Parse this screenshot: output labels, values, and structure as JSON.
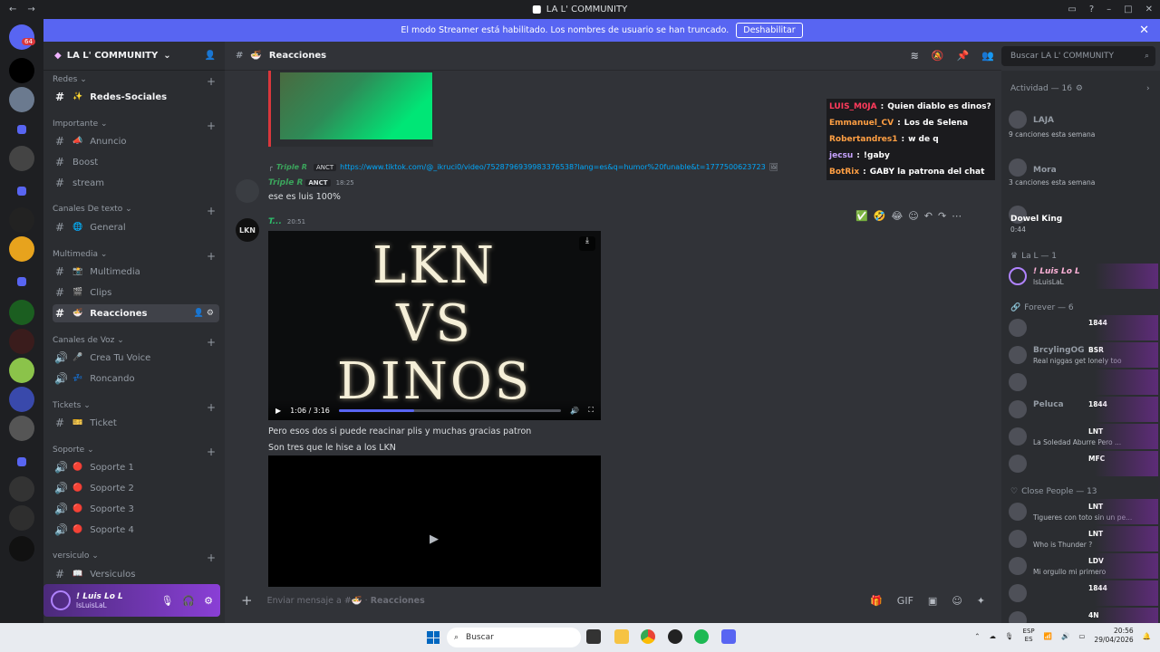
{
  "window": {
    "title": "LA L' COMMUNITY"
  },
  "banner": {
    "text": "El modo Streamer está habilitado. Los nombres de usuario se han truncado.",
    "button": "Deshabilitar"
  },
  "guild_badge": "64",
  "server": {
    "name": "LA L' COMMUNITY"
  },
  "categories": [
    {
      "name": "Redes",
      "channels": [
        {
          "name": "Redes-Sociales",
          "emoji": "✨"
        }
      ]
    },
    {
      "name": "Importante",
      "channels": [
        {
          "name": "Anuncio",
          "emoji": "📣"
        },
        {
          "name": "Boost",
          "emoji": ""
        },
        {
          "name": "stream",
          "emoji": ""
        }
      ]
    },
    {
      "name": "Canales De texto",
      "channels": [
        {
          "name": "General",
          "emoji": "🌐"
        }
      ]
    },
    {
      "name": "Multimedia",
      "channels": [
        {
          "name": "Multimedia",
          "emoji": "📸"
        },
        {
          "name": "Clips",
          "emoji": "🎬"
        },
        {
          "name": "Reacciones",
          "emoji": "🍜"
        }
      ]
    },
    {
      "name": "Canales de Voz",
      "channels": [
        {
          "name": "Crea Tu Voice",
          "emoji": "🎤"
        },
        {
          "name": "Roncando",
          "emoji": "💤"
        }
      ]
    },
    {
      "name": "Tickets",
      "channels": [
        {
          "name": "Ticket",
          "emoji": "🎫"
        }
      ]
    },
    {
      "name": "Soporte",
      "channels": [
        {
          "name": "Soporte 1",
          "emoji": "🔴"
        },
        {
          "name": "Soporte 2",
          "emoji": "🔴"
        },
        {
          "name": "Soporte 3",
          "emoji": "🔴"
        },
        {
          "name": "Soporte 4",
          "emoji": "🔴"
        }
      ]
    },
    {
      "name": "versiculo",
      "channels": [
        {
          "name": "Versiculos",
          "emoji": "📖"
        }
      ]
    }
  ],
  "user": {
    "name": "! Luis Lo L",
    "sub": "lsLuisLaL"
  },
  "channel": {
    "name": "Reacciones",
    "emoji": "🍜"
  },
  "search": {
    "placeholder": "Buscar LA L' COMMUNITY"
  },
  "messages": {
    "reply": {
      "user": "Triple R",
      "tag": "ANCT",
      "link": "https://www.tiktok.com/@_ikruci0/video/7528796939983376538?lang=es&q=humor%20funable&t=1777500623723"
    },
    "msg1": {
      "user": "Triple R",
      "tag": "ANCT",
      "time": "18:25",
      "text": "ese es luis 100%"
    },
    "msg2": {
      "user": "T...",
      "time": "20:51",
      "avatar_text": "LKN"
    },
    "video": {
      "title_lines": [
        "LKN",
        "VS",
        "DINOS"
      ],
      "time": "1:06 / 3:16",
      "progress": 0.34
    },
    "text2": "Pero esos dos si puede reacinar plis y muchas gracias patron",
    "text3": "Son tres que le hise a los LKN"
  },
  "overlay_chat": [
    {
      "user": "LUIS_M0JA",
      "text": "Quien diablo es dinos?",
      "color": "#ff3b5c"
    },
    {
      "user": "Emmanuel_CV",
      "text": "Los de Selena",
      "color": "#ffffff"
    },
    {
      "user": "Robertandres1",
      "text": "w de q",
      "color": "#ffffff"
    },
    {
      "user": "jecsu",
      "text": "!gaby",
      "color": "#c7a3ff"
    },
    {
      "user": "BotRix",
      "text": "GABY la patrona del chat",
      "color": "#ffffff"
    }
  ],
  "composer": {
    "placeholder_prefix": "Enviar mensaje a #",
    "channel": "Reacciones"
  },
  "members": {
    "activity": "Actividad — 16",
    "activity_items": [
      {
        "name": "LAJA",
        "sub": "9 canciones esta semana"
      },
      {
        "name": "Mora",
        "sub": "3 canciones esta semana"
      },
      {
        "name": "Dowel King",
        "sub": "0:44"
      }
    ],
    "group1": {
      "name": "La L — 1",
      "member": {
        "name": "! Luis Lo L",
        "sub": "lsLuisLaL"
      }
    },
    "group2": {
      "name": "Forever — 6",
      "members": [
        {
          "name": "",
          "badge": "1844",
          "sub": ""
        },
        {
          "name": "BrcylingOG",
          "badge": "BSR",
          "sub": "Real niggas get lonely too"
        },
        {
          "name": "",
          "badge": "",
          "sub": ""
        },
        {
          "name": "Peluca",
          "badge": "1844",
          "sub": ""
        },
        {
          "name": "",
          "badge": "LNT",
          "sub": "La Soledad Aburre Pero ..."
        },
        {
          "name": "",
          "badge": "MFC",
          "sub": ""
        }
      ]
    },
    "group3": {
      "name": "Close People — 13",
      "members": [
        {
          "name": "",
          "badge": "LNT",
          "sub": "Tigueres con toto sin un pe..."
        },
        {
          "name": "",
          "badge": "LNT",
          "sub": "Who is Thunder ?"
        },
        {
          "name": "",
          "badge": "LDV",
          "sub": "Mi orgullo mi primero"
        },
        {
          "name": "",
          "badge": "1844",
          "sub": ""
        },
        {
          "name": "",
          "badge": "4N",
          "sub": ""
        }
      ]
    }
  },
  "taskbar": {
    "search": "Buscar",
    "lang1": "ESP",
    "lang2": "ES",
    "time": "20:56",
    "date": "29/04/2026"
  }
}
